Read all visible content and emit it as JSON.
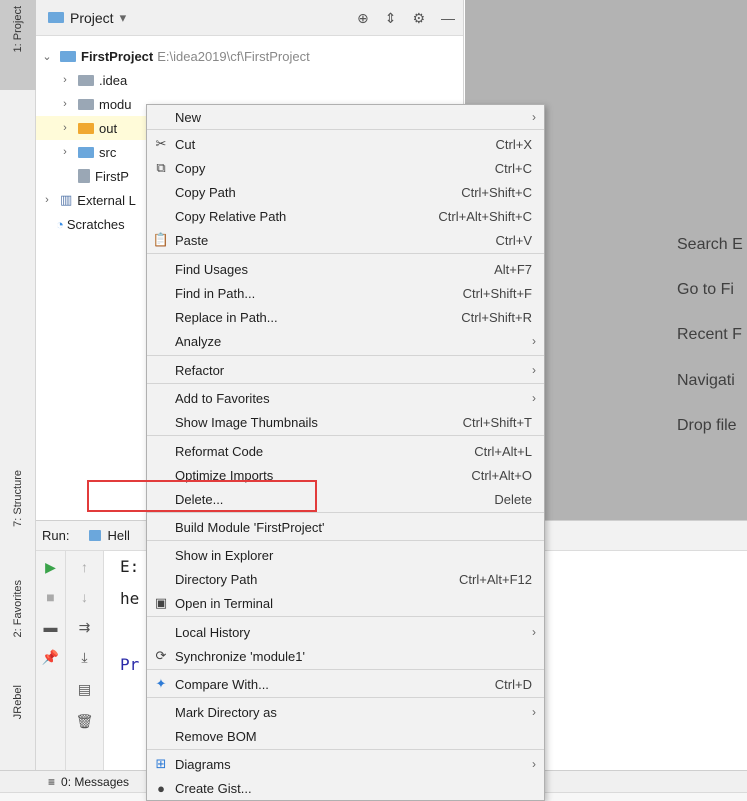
{
  "left_strip": {
    "tabs": [
      "1: Project",
      "7: Structure",
      "2: Favorites",
      "JRebel"
    ]
  },
  "project_panel": {
    "title": "Project",
    "title_caret": "▾",
    "header_icons": [
      "target-icon",
      "collapse-icon",
      "gear-icon",
      "minimize-icon"
    ],
    "tree": [
      {
        "name": "FirstProject",
        "path": "E:\\idea2019\\cf\\FirstProject"
      },
      {
        "name": ".idea"
      },
      {
        "name": "modu"
      },
      {
        "name": "out"
      },
      {
        "name": "src"
      },
      {
        "name": "FirstP"
      },
      {
        "name": "External L"
      },
      {
        "name": "Scratches"
      }
    ]
  },
  "editor_hints": [
    "Search E",
    "Go to Fi",
    "Recent F",
    "Navigati",
    "Drop file"
  ],
  "run_panel": {
    "label": "Run:",
    "tab": "Hell",
    "console": [
      "E:",
      "he",
      "Pr"
    ]
  },
  "status_bar": {
    "messages": "0: Messages"
  },
  "context_menu": {
    "items": [
      {
        "label": "New",
        "shortcut": "",
        "submenu": true,
        "icon": ""
      },
      {
        "label": "Cut",
        "shortcut": "Ctrl+X",
        "submenu": false,
        "icon": "✂"
      },
      {
        "label": "Copy",
        "shortcut": "Ctrl+C",
        "submenu": false,
        "icon": "⧉"
      },
      {
        "label": "Copy Path",
        "shortcut": "Ctrl+Shift+C",
        "submenu": false,
        "icon": ""
      },
      {
        "label": "Copy Relative Path",
        "shortcut": "Ctrl+Alt+Shift+C",
        "submenu": false,
        "icon": ""
      },
      {
        "label": "Paste",
        "shortcut": "Ctrl+V",
        "submenu": false,
        "icon": "📋"
      },
      {
        "label": "Find Usages",
        "shortcut": "Alt+F7",
        "submenu": false,
        "icon": ""
      },
      {
        "label": "Find in Path...",
        "shortcut": "Ctrl+Shift+F",
        "submenu": false,
        "icon": ""
      },
      {
        "label": "Replace in Path...",
        "shortcut": "Ctrl+Shift+R",
        "submenu": false,
        "icon": ""
      },
      {
        "label": "Analyze",
        "shortcut": "",
        "submenu": true,
        "icon": ""
      },
      {
        "label": "Refactor",
        "shortcut": "",
        "submenu": true,
        "icon": ""
      },
      {
        "label": "Add to Favorites",
        "shortcut": "",
        "submenu": true,
        "icon": ""
      },
      {
        "label": "Show Image Thumbnails",
        "shortcut": "Ctrl+Shift+T",
        "submenu": false,
        "icon": ""
      },
      {
        "label": "Reformat Code",
        "shortcut": "Ctrl+Alt+L",
        "submenu": false,
        "icon": ""
      },
      {
        "label": "Optimize Imports",
        "shortcut": "Ctrl+Alt+O",
        "submenu": false,
        "icon": ""
      },
      {
        "label": "Delete...",
        "shortcut": "Delete",
        "submenu": false,
        "icon": ""
      },
      {
        "label": "Build Module 'FirstProject'",
        "shortcut": "",
        "submenu": false,
        "icon": ""
      },
      {
        "label": "Show in Explorer",
        "shortcut": "",
        "submenu": false,
        "icon": ""
      },
      {
        "label": "Directory Path",
        "shortcut": "Ctrl+Alt+F12",
        "submenu": false,
        "icon": ""
      },
      {
        "label": "Open in Terminal",
        "shortcut": "",
        "submenu": false,
        "icon": "▣"
      },
      {
        "label": "Local History",
        "shortcut": "",
        "submenu": true,
        "icon": ""
      },
      {
        "label": "Synchronize 'module1'",
        "shortcut": "",
        "submenu": false,
        "icon": "⟳"
      },
      {
        "label": "Compare With...",
        "shortcut": "Ctrl+D",
        "submenu": false,
        "icon": "✦"
      },
      {
        "label": "Mark Directory as",
        "shortcut": "",
        "submenu": true,
        "icon": ""
      },
      {
        "label": "Remove BOM",
        "shortcut": "",
        "submenu": false,
        "icon": ""
      },
      {
        "label": "Diagrams",
        "shortcut": "",
        "submenu": true,
        "icon": "⊞"
      },
      {
        "label": "Create Gist...",
        "shortcut": "",
        "submenu": false,
        "icon": "●"
      }
    ]
  }
}
